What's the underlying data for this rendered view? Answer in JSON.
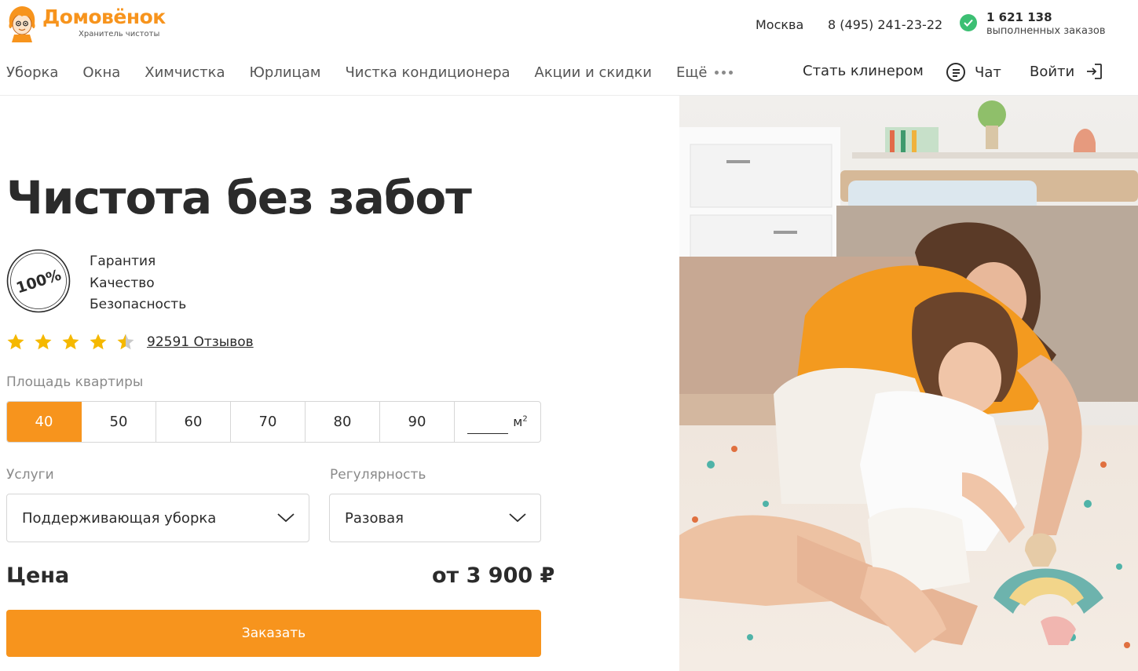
{
  "brand": {
    "name": "Домовёнок",
    "tagline": "Хранитель чистоты"
  },
  "header": {
    "city": "Москва",
    "phone": "8 (495) 241-23-22",
    "orders_count": "1 621 138",
    "orders_label": "выполненных заказов"
  },
  "nav": {
    "items": [
      {
        "label": "Уборка"
      },
      {
        "label": "Окна"
      },
      {
        "label": "Химчистка"
      },
      {
        "label": "Юрлицам"
      },
      {
        "label": "Чистка кондиционера"
      },
      {
        "label": "Акции и скидки"
      },
      {
        "label": "Ещё"
      }
    ],
    "become_cleaner": "Стать клинером",
    "chat": "Чат",
    "login": "Войти"
  },
  "hero": {
    "title": "Чистота без забот",
    "badge_text": "100%",
    "guarantees": [
      "Гарантия",
      "Качество",
      "Безопасность"
    ],
    "rating": 4.5,
    "reviews_link": "92591 Отзывов"
  },
  "calculator": {
    "area_label": "Площадь квартиры",
    "area_options": [
      "40",
      "50",
      "60",
      "70",
      "80",
      "90"
    ],
    "area_selected": "40",
    "area_custom_value": "",
    "area_unit": "м",
    "area_unit_sup": "2",
    "services_label": "Услуги",
    "services_value": "Поддерживающая уборка",
    "regularity_label": "Регулярность",
    "regularity_value": "Разовая",
    "price_label": "Цена",
    "price_value": "от 3 900 ₽",
    "order_button": "Заказать"
  },
  "colors": {
    "accent": "#f7941d",
    "check": "#3cbf73",
    "text": "#2b2b2b",
    "muted": "#8a8a8a",
    "star": "#f5b800"
  },
  "icons": {
    "logo": "domovenok-mascot-icon",
    "orders": "check-circle-icon",
    "more": "more-dots-icon",
    "chat": "chat-bubble-icon",
    "login": "login-arrow-icon",
    "badge": "guarantee-100-percent-icon",
    "select": "chevron-down-icon"
  }
}
